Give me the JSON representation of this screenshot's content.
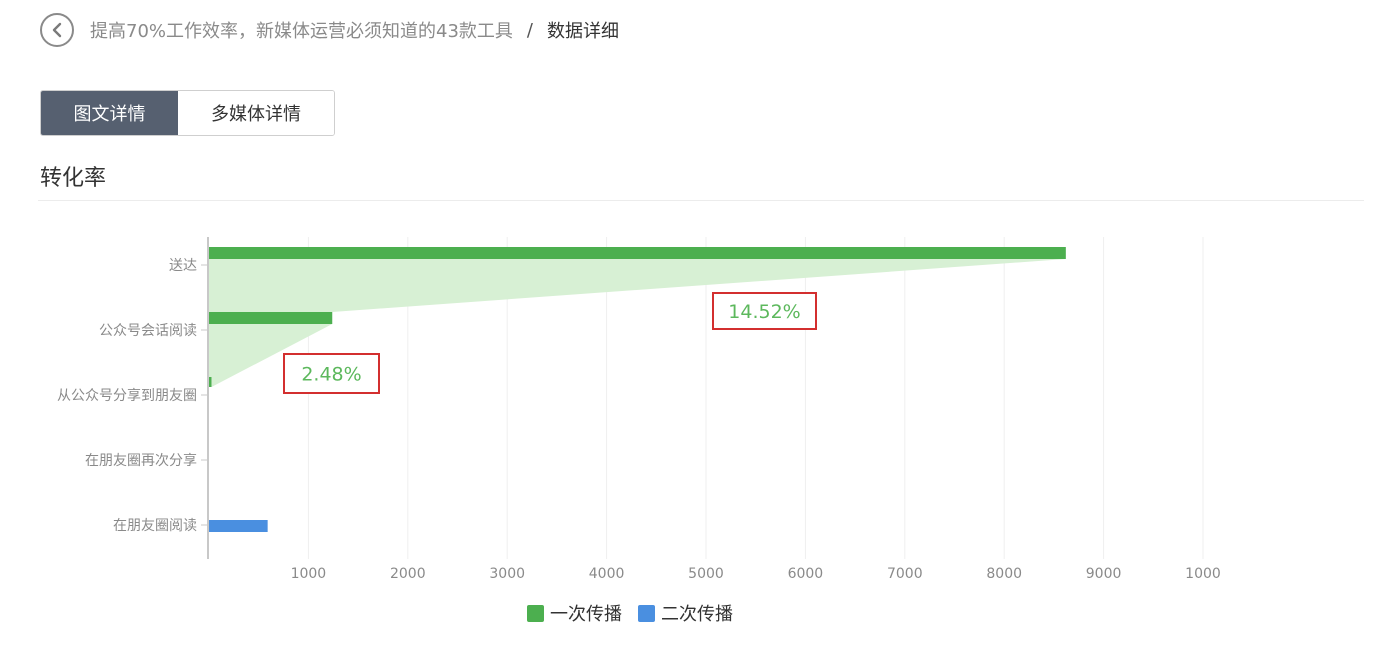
{
  "header": {
    "back_icon": "chevron-left-icon",
    "crumb_parent": "提高70%工作效率，新媒体运营必须知道的43款工具",
    "crumb_separator": "/",
    "crumb_current": "数据详细"
  },
  "tabs": [
    {
      "label": "图文详情",
      "active": true
    },
    {
      "label": "多媒体详情",
      "active": false
    }
  ],
  "section": {
    "title": "转化率"
  },
  "colors": {
    "primary_series": "#4caf4f",
    "secondary_series": "#4a8fe0",
    "funnel_fill": "#d7f0d4",
    "highlight_box": "#d32f2f",
    "annotation_text": "#5cb85c"
  },
  "legend": {
    "items": [
      {
        "label": "一次传播",
        "color": "#4caf4f"
      },
      {
        "label": "二次传播",
        "color": "#4a8fe0"
      }
    ]
  },
  "chart_data": {
    "type": "bar",
    "orientation": "horizontal",
    "categories": [
      "送达",
      "公众号会话阅读",
      "从公众号分享到朋友圈",
      "在朋友圈再次分享",
      "在朋友圈阅读"
    ],
    "series": [
      {
        "name": "一次传播",
        "values": [
          8620,
          1240,
          25,
          0,
          0
        ]
      },
      {
        "name": "二次传播",
        "values": [
          0,
          0,
          0,
          0,
          590
        ]
      }
    ],
    "x_ticks": [
      1000,
      2000,
      3000,
      4000,
      5000,
      6000,
      7000,
      8000,
      9000
    ],
    "x_tick_labels": [
      "1000",
      "2000",
      "3000",
      "4000",
      "5000",
      "6000",
      "7000",
      "8000",
      "9000",
      "1000"
    ],
    "xlim": [
      0,
      11000
    ],
    "grid": true,
    "legend_position": "bottom-center",
    "annotations": [
      {
        "text": "14.52%",
        "between": [
          "送达",
          "公众号会话阅读"
        ]
      },
      {
        "text": "2.48%",
        "between": [
          "公众号会话阅读",
          "从公众号分享到朋友圈"
        ]
      }
    ]
  }
}
